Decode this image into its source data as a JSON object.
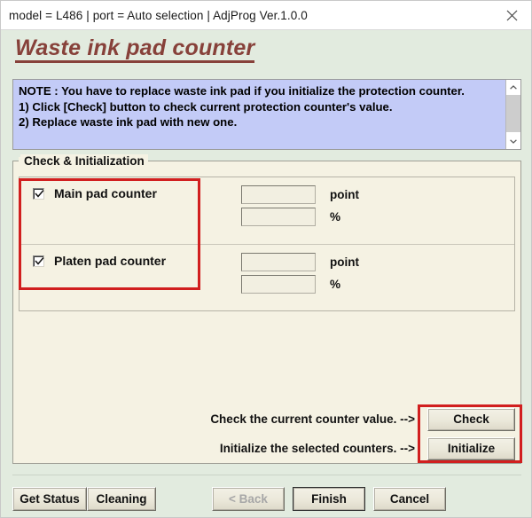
{
  "window": {
    "title": "model = L486 | port = Auto selection | AdjProg Ver.1.0.0",
    "close_icon": "close-icon"
  },
  "page": {
    "heading": "Waste ink pad counter"
  },
  "note": {
    "line1": "NOTE : You have to replace waste ink pad if you initialize the protection counter.",
    "line2": "1) Click [Check] button to check current protection counter's value.",
    "line3": "2) Replace waste ink pad with new one.",
    "scroll_up_icon": "chevron-up-icon",
    "scroll_down_icon": "chevron-down-icon"
  },
  "group": {
    "title": "Check & Initialization",
    "counters": [
      {
        "label": "Main pad counter",
        "checked": true,
        "point_value": "",
        "point_unit": "point",
        "percent_value": "",
        "percent_unit": "%"
      },
      {
        "label": "Platen pad counter",
        "checked": true,
        "point_value": "",
        "point_unit": "point",
        "percent_value": "",
        "percent_unit": "%"
      }
    ],
    "actions": [
      {
        "prompt": "Check the current counter value. -->",
        "button": "Check"
      },
      {
        "prompt": "Initialize the selected counters. -->",
        "button": "Initialize"
      }
    ]
  },
  "footer": {
    "get_status": "Get Status",
    "cleaning": "Cleaning",
    "back": "< Back",
    "finish": "Finish",
    "cancel": "Cancel"
  },
  "colors": {
    "dialog_bg": "#e2ebdf",
    "panel_bg": "#f5f2e3",
    "note_bg": "#c3cbf7",
    "heading": "#87413a",
    "annotation": "#d11f1f"
  }
}
